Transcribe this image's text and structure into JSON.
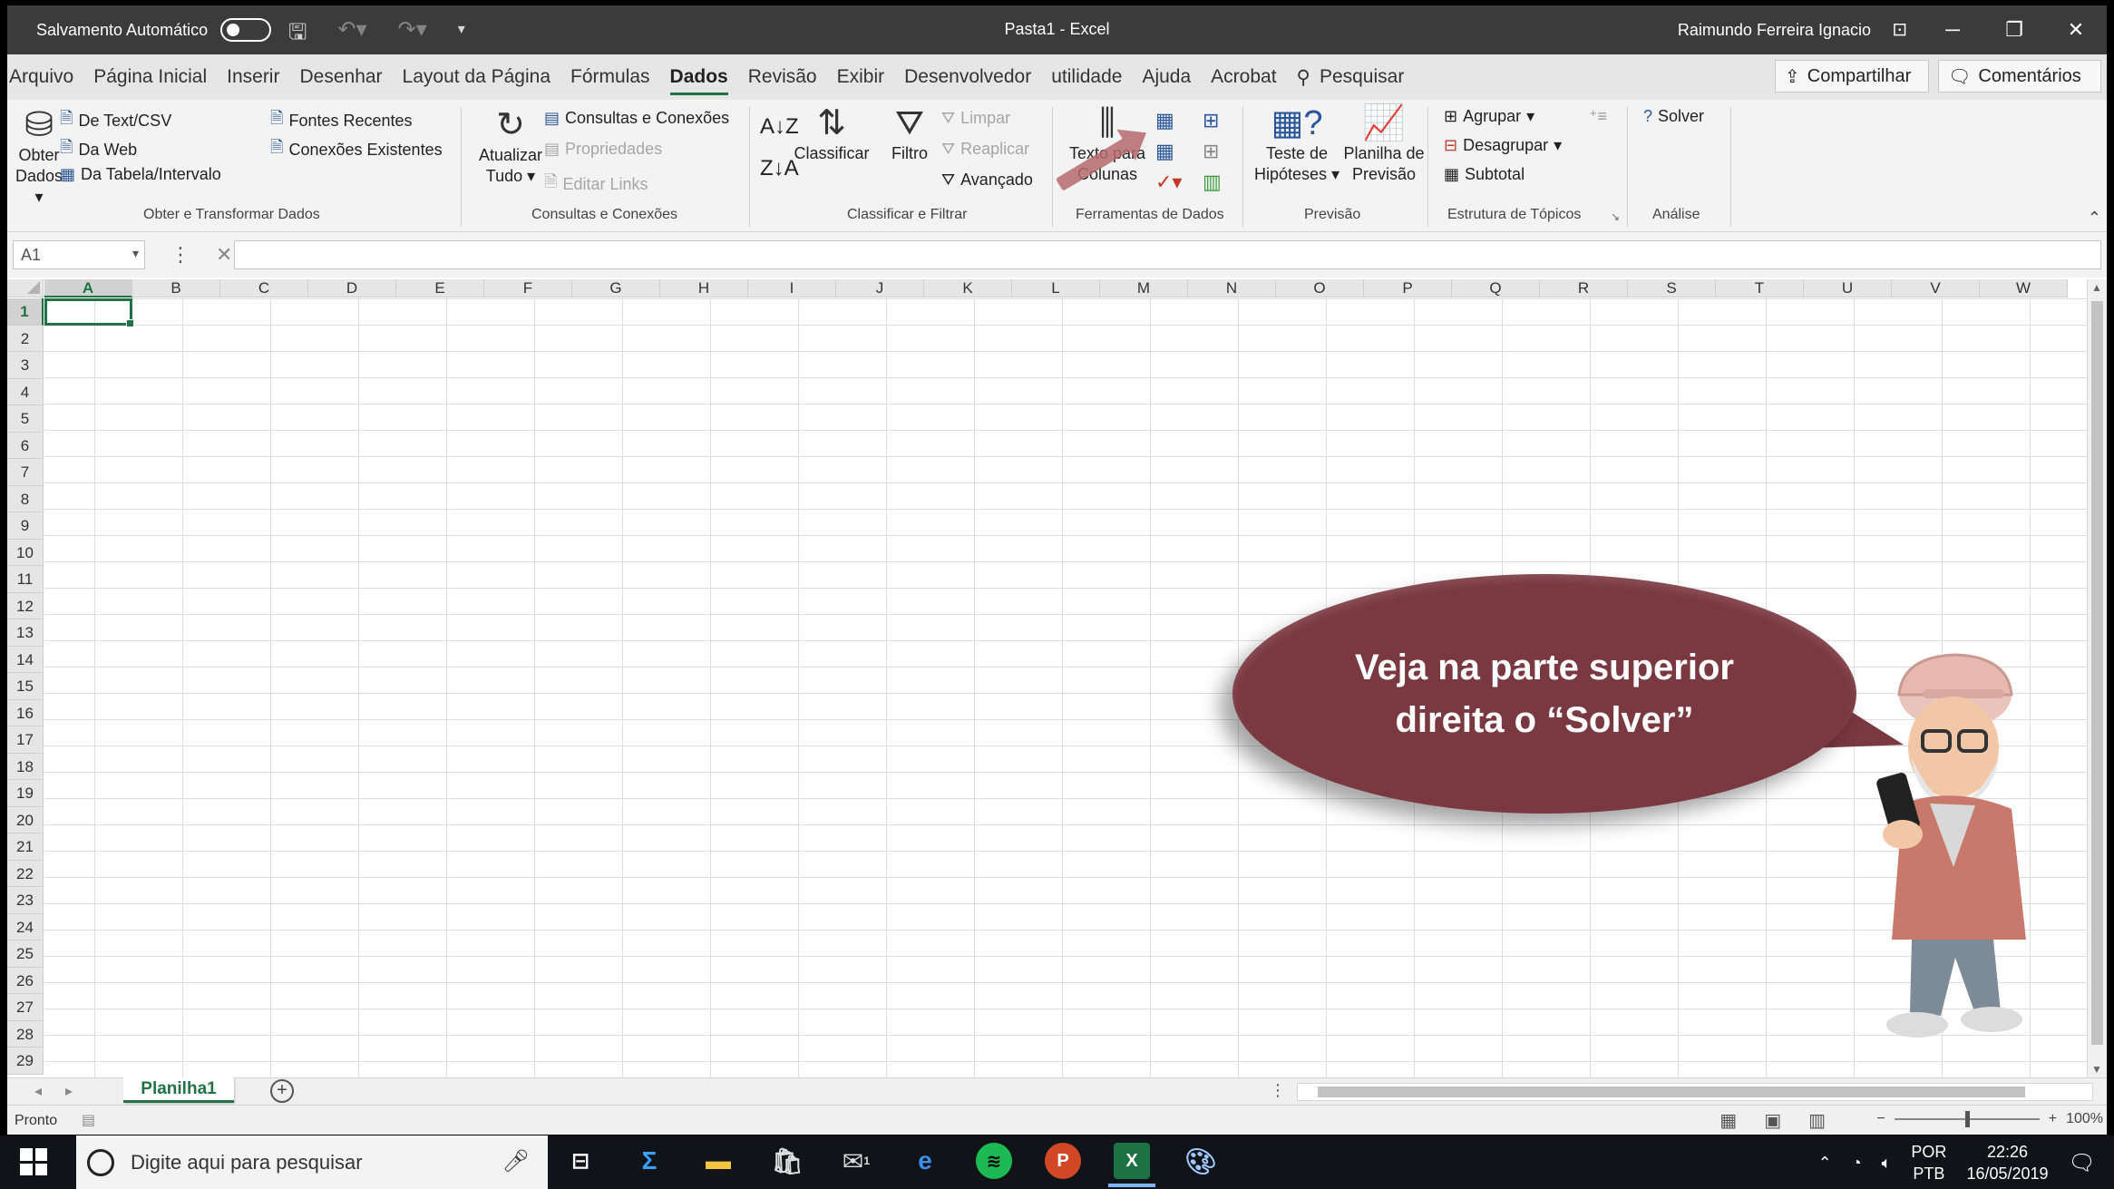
{
  "titlebar": {
    "autosave_label": "Salvamento Automático",
    "doc_title": "Pasta1  -  Excel",
    "user": "Raimundo Ferreira Ignacio"
  },
  "tabs": [
    "Arquivo",
    "Página Inicial",
    "Inserir",
    "Desenhar",
    "Layout da Página",
    "Fórmulas",
    "Dados",
    "Revisão",
    "Exibir",
    "Desenvolvedor",
    "utilidade",
    "Ajuda",
    "Acrobat"
  ],
  "search_tab": "Pesquisar",
  "share": "Compartilhar",
  "comments": "Comentários",
  "ribbon": {
    "get_data": "Obter Dados",
    "from_text": "De Text/CSV",
    "from_web": "Da Web",
    "from_table": "Da Tabela/Intervalo",
    "recent_sources": "Fontes Recentes",
    "existing_connections": "Conexões Existentes",
    "group_get": "Obter e Transformar Dados",
    "refresh_all": "Atualizar Tudo",
    "queries_connections": "Consultas e Conexões",
    "properties": "Propriedades",
    "edit_links": "Editar Links",
    "group_queries": "Consultas e Conexões",
    "sort": "Classificar",
    "filter": "Filtro",
    "clear": "Limpar",
    "reapply": "Reaplicar",
    "advanced": "Avançado",
    "group_sort": "Classificar e Filtrar",
    "text_to_columns": "Texto para Colunas",
    "group_tools": "Ferramentas de Dados",
    "what_if": "Teste de Hipóteses",
    "forecast_sheet": "Planilha de Previsão",
    "group_forecast": "Previsão",
    "group": "Agrupar",
    "ungroup": "Desagrupar",
    "subtotal": "Subtotal",
    "group_outline": "Estrutura de Tópicos",
    "solver": "Solver",
    "group_analysis": "Análise"
  },
  "formula_bar": {
    "name_box": "A1",
    "formula": ""
  },
  "columns": [
    "A",
    "B",
    "C",
    "D",
    "E",
    "F",
    "G",
    "H",
    "I",
    "J",
    "K",
    "L",
    "M",
    "N",
    "O",
    "P",
    "Q",
    "R",
    "S",
    "T",
    "U",
    "V",
    "W"
  ],
  "rows": [
    "1",
    "2",
    "3",
    "4",
    "5",
    "6",
    "7",
    "8",
    "9",
    "10",
    "11",
    "12",
    "13",
    "14",
    "15",
    "16",
    "17",
    "18",
    "19",
    "20",
    "21",
    "22",
    "23",
    "24",
    "25",
    "26",
    "27",
    "28",
    "29"
  ],
  "callout": {
    "line1": "Veja na parte superior",
    "line2": "direita o “Solver”"
  },
  "sheet_tab": "Planilha1",
  "status": {
    "text": "Pronto",
    "zoom": "100%"
  },
  "taskbar": {
    "search_placeholder": "Digite aqui para pesquisar",
    "lang_top": "POR",
    "lang_bottom": "PTB",
    "time": "22:26",
    "date": "16/05/2019",
    "mail_badge": "1"
  },
  "colors": {
    "excel_green": "#217346",
    "bubble": "#7a3840"
  }
}
